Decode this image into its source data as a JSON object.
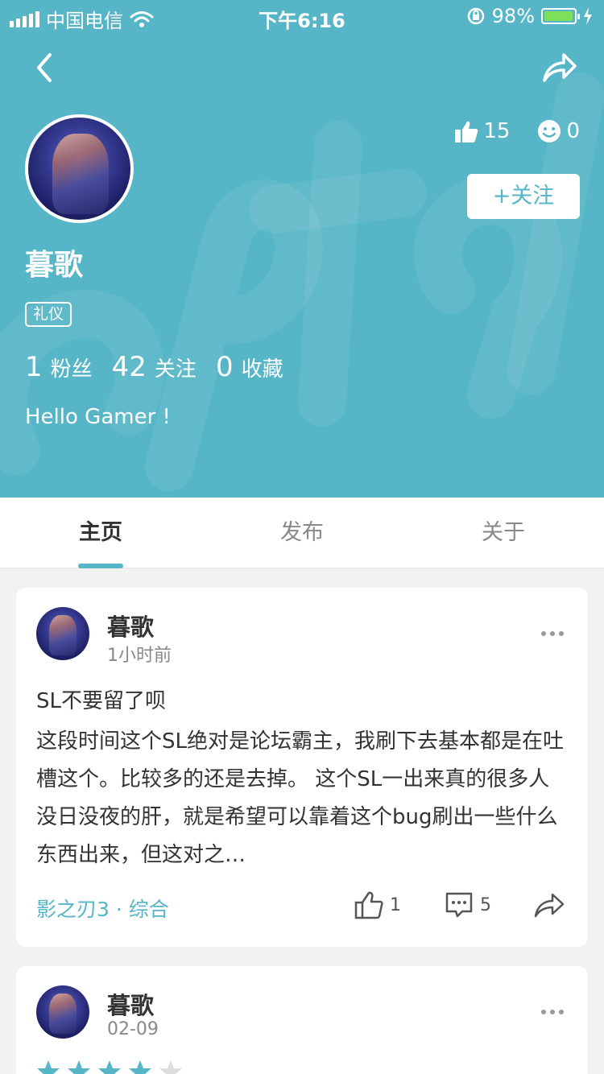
{
  "status_bar": {
    "carrier": "中国电信",
    "time": "下午6:16",
    "battery": "98%",
    "battery_level": 0.98
  },
  "profile": {
    "name": "暮歌",
    "tag": "礼仪",
    "likes": "15",
    "smiles": "0",
    "follow_label": "+关注",
    "stats": [
      {
        "num": "1",
        "label": "粉丝"
      },
      {
        "num": "42",
        "label": "关注"
      },
      {
        "num": "0",
        "label": "收藏"
      }
    ],
    "bio": "Hello Gamer !"
  },
  "tabs": [
    {
      "label": "主页",
      "active": true
    },
    {
      "label": "发布",
      "active": false
    },
    {
      "label": "关于",
      "active": false
    }
  ],
  "posts": [
    {
      "author": "暮歌",
      "time": "1小时前",
      "title": "SL不要留了呗",
      "body": "这段时间这个SL绝对是论坛霸主，我刷下去基本都是在吐槽这个。比较多的还是去掉。 这个SL一出来真的很多人没日没夜的肝，就是希望可以靠着这个bug刷出一些什么东西出来，但这对之…",
      "forum": "影之刃3 · 综合",
      "likes": "1",
      "comments": "5"
    },
    {
      "author": "暮歌",
      "time": "02-09",
      "rating": 4,
      "rating_max": 5
    }
  ],
  "colors": {
    "accent": "#56b5c6",
    "battery": "#7ee05a"
  },
  "icons": [
    "chevron-left-icon",
    "share-icon",
    "thumbs-up-icon",
    "smile-icon",
    "comment-icon",
    "more-icon",
    "star-icon",
    "wifi-icon",
    "lock-rotation-icon",
    "charging-icon"
  ]
}
